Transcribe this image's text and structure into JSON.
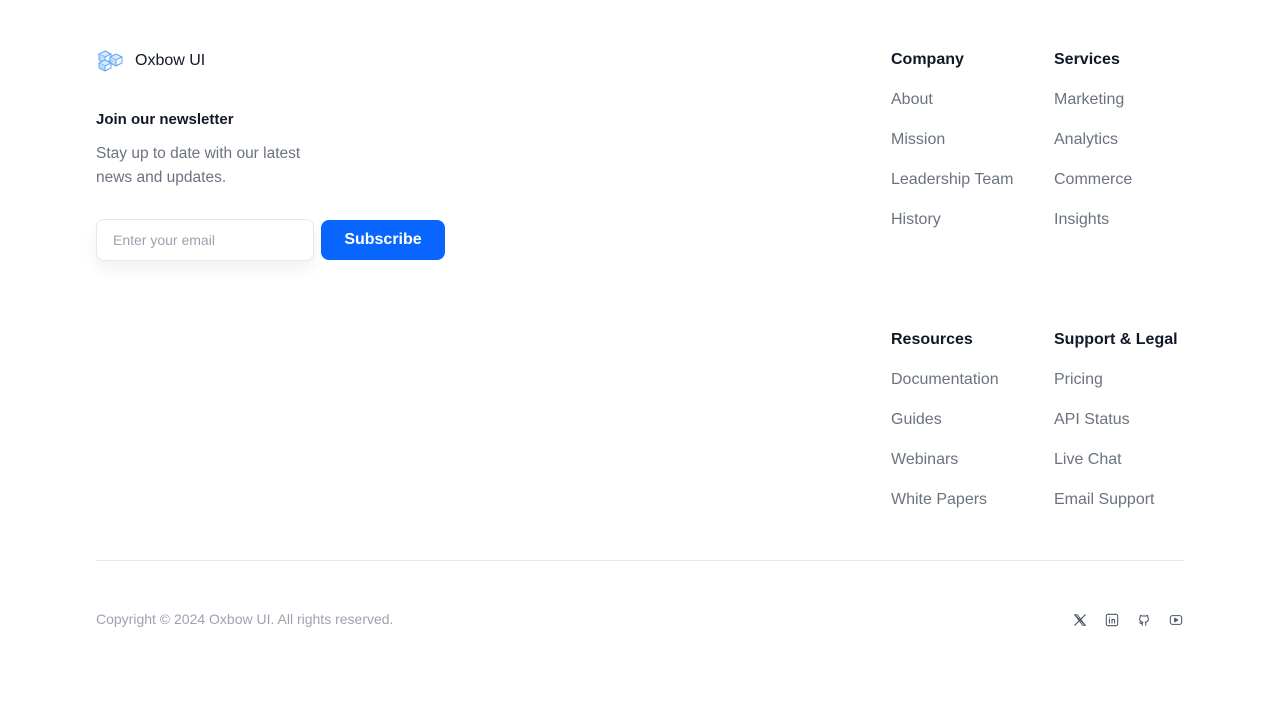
{
  "brand": {
    "name": "Oxbow UI",
    "logo_icon": "cubes-logo-icon"
  },
  "newsletter": {
    "title": "Join our newsletter",
    "description": "Stay up to date with our latest news and updates.",
    "email_placeholder": "Enter your email",
    "email_value": "",
    "subscribe_label": "Subscribe"
  },
  "columns": [
    {
      "heading": "Company",
      "links": [
        "About",
        "Mission",
        "Leadership Team",
        "History"
      ]
    },
    {
      "heading": "Services",
      "links": [
        "Marketing",
        "Analytics",
        "Commerce",
        "Insights"
      ]
    },
    {
      "heading": "Resources",
      "links": [
        "Documentation",
        "Guides",
        "Webinars",
        "White Papers"
      ]
    },
    {
      "heading": "Support & Legal",
      "links": [
        "Pricing",
        "API Status",
        "Live Chat",
        "Email Support"
      ]
    }
  ],
  "footer": {
    "copyright": "Copyright © 2024 Oxbow UI. All rights reserved.",
    "socials": [
      "x-icon",
      "linkedin-icon",
      "github-icon",
      "youtube-icon"
    ]
  },
  "colors": {
    "accent": "#0866ff",
    "heading": "#111827",
    "muted": "#6b7280",
    "subtle": "#9ca3af"
  }
}
